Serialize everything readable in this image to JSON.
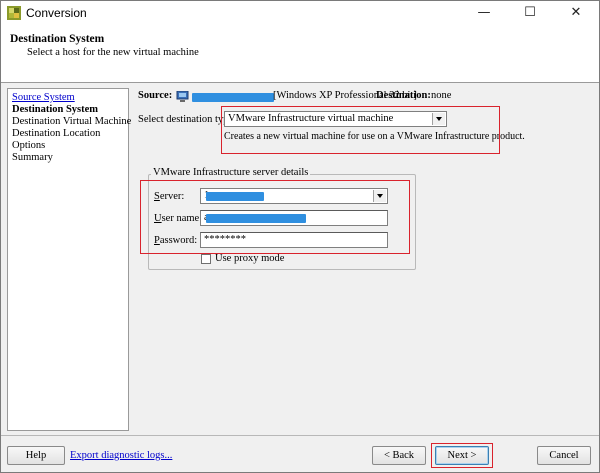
{
  "window": {
    "title": "Conversion",
    "minimize_glyph": "—",
    "maximize_glyph": "☐",
    "close_glyph": "✕"
  },
  "header": {
    "title": "Destination System",
    "subtitle": "Select a host for the new virtual machine"
  },
  "nav": {
    "items": [
      {
        "label": "Source System",
        "state": "link"
      },
      {
        "label": "Destination System",
        "state": "current"
      },
      {
        "label": "Destination Virtual Machine",
        "state": "normal"
      },
      {
        "label": "Destination Location",
        "state": "normal"
      },
      {
        "label": "Options",
        "state": "normal"
      },
      {
        "label": "Summary",
        "state": "normal"
      }
    ]
  },
  "source": {
    "label": "Source:",
    "os": "[Windows XP Professional 32 bit]",
    "destination_label": "Destination:",
    "destination_value": "none"
  },
  "dest_type": {
    "label": "Select destination type:",
    "selected": "VMware Infrastructure virtual machine",
    "description": "Creates a new virtual machine for use on a VMware Infrastructure product."
  },
  "server_details": {
    "group_title": "VMware Infrastructure server details",
    "server_label": "Server:",
    "server_value": "1",
    "username_label": "User name:",
    "username_value": "a",
    "password_label": "Password:",
    "password_value": "********",
    "proxy_label": "Use proxy mode",
    "proxy_checked": false
  },
  "footer": {
    "help_label": "Help",
    "export_link": "Export diagnostic logs...",
    "back_label": "< Back",
    "next_label": "Next >",
    "cancel_label": "Cancel"
  },
  "colors": {
    "highlight_red": "#d9232d",
    "redaction_blue": "#2f8fe0",
    "link_blue": "#0000cc"
  },
  "icons": {
    "app": "vmware-converter-icon",
    "source": "computer-icon"
  }
}
